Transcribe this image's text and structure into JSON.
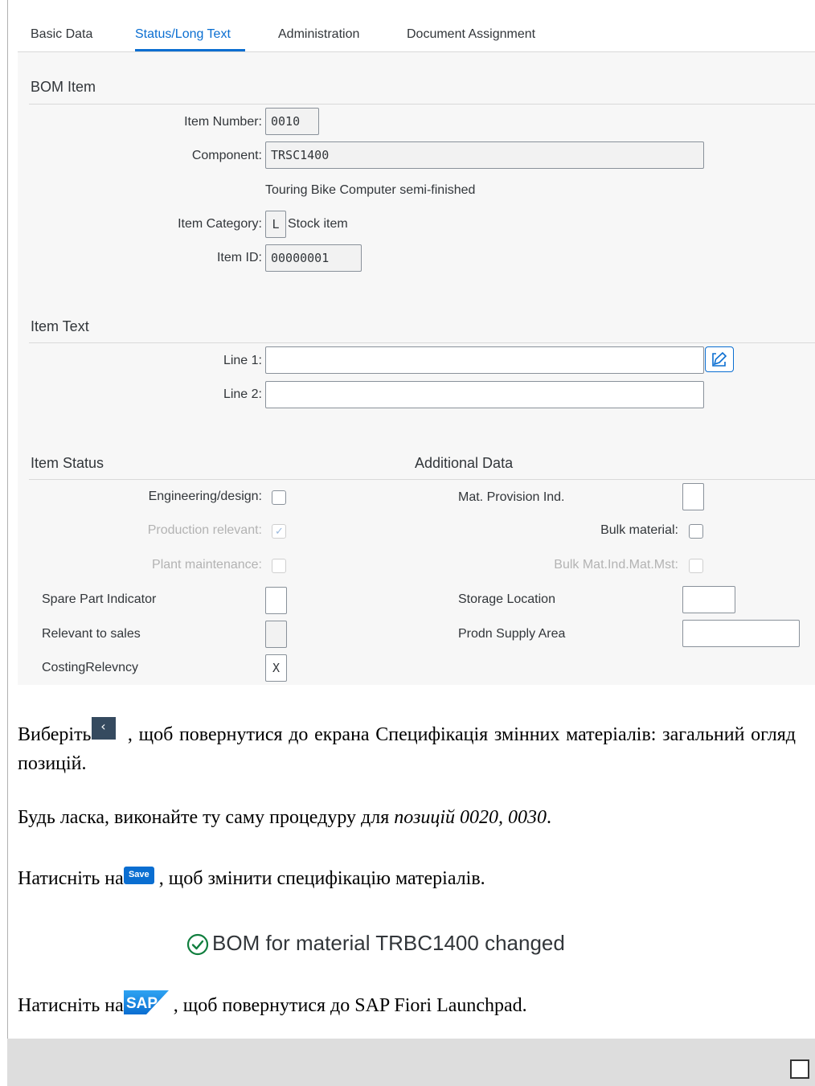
{
  "tabs": [
    "Basic Data",
    "Status/Long Text",
    "Administration",
    "Document Assignment"
  ],
  "bom_item": {
    "title": "BOM Item",
    "item_number_label": "Item Number:",
    "item_number": "0010",
    "component_label": "Component:",
    "component": "TRSC1400",
    "component_desc": "Touring Bike Computer semi-finished",
    "item_category_label": "Item Category:",
    "item_category": "L",
    "item_category_text": "Stock item",
    "item_id_label": "Item ID:",
    "item_id": "00000001"
  },
  "item_text": {
    "title": "Item Text",
    "line1_label": "Line 1:",
    "line1": "",
    "line2_label": "Line 2:",
    "line2": ""
  },
  "item_status": {
    "title": "Item Status",
    "engineering_label": "Engineering/design:",
    "production_label": "Production relevant:",
    "plant_label": "Plant maintenance:",
    "spare_part_label": "Spare Part Indicator",
    "spare_part": "",
    "relevant_sales_label": "Relevant to sales",
    "relevant_sales": "",
    "costing_label": "CostingRelevncy",
    "costing": "X"
  },
  "additional_data": {
    "title": "Additional Data",
    "mat_provision_label": "Mat. Provision Ind.",
    "mat_provision": "",
    "bulk_material_label": "Bulk material:",
    "bulk_mat_ind_label": "Bulk Mat.Ind.Mat.Mst:",
    "storage_location_label": "Storage Location",
    "storage_location": "",
    "prodn_supply_area_label": "Prodn Supply Area",
    "prodn_supply_area": ""
  },
  "doc": {
    "p1_a": "Виберіть",
    "p1_b": ", щоб повернутися до екрана Специфікація змінних матеріалів: загальний огляд позицій.",
    "p2_a": "Будь ласка, виконайте ту саму процедуру для ",
    "p2_em": "позицій 0020, 0030",
    "p2_c": ".",
    "p3_a": "Натисніть на",
    "p3_b": ", щоб змінити специфікацію матеріалів.",
    "save_btn": "Save",
    "back_glyph": "‹",
    "message": "BOM for material TRBC1400 changed",
    "p4_a": "Натисніть на",
    "p4_b": ", щоб повернутися до SAP Fiori Launchpad.",
    "sap_logo": "SAP"
  },
  "colors": {
    "accent": "#0a6ed1",
    "success": "#107e3e",
    "shell": "#354a5f"
  }
}
